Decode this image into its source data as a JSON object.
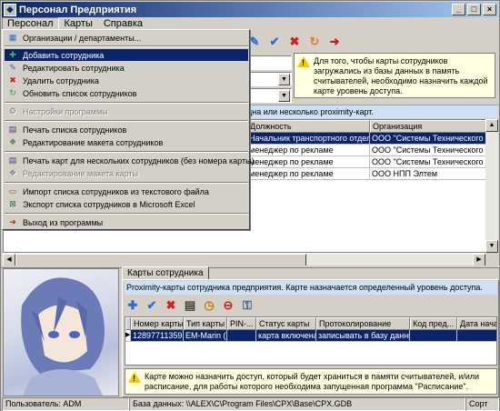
{
  "window": {
    "title": "Персонал Предприятия",
    "controls": [
      "_",
      "□",
      "×"
    ]
  },
  "menubar": {
    "items": [
      "Персонал",
      "Карты",
      "Справка"
    ]
  },
  "dropdown": {
    "items": [
      {
        "label": "Организации / департаменты...",
        "icon": "org-icon"
      },
      {
        "label": "Добавить сотрудника",
        "icon": "add-user-icon"
      },
      {
        "label": "Редактировать сотрудника",
        "icon": "edit-user-icon"
      },
      {
        "label": "Удалить сотрудника",
        "icon": "delete-user-icon"
      },
      {
        "label": "Обновить список сотрудников",
        "icon": "refresh-icon"
      },
      {
        "label": "Настройки программы",
        "icon": "settings-icon"
      },
      {
        "label": "Печать списка сотрудников",
        "icon": "print-icon"
      },
      {
        "label": "Редактирование макета сотрудников",
        "icon": "layout-icon"
      },
      {
        "label": "Печать карт для нескольких сотрудников (без номера карты)",
        "icon": "print-cards-icon"
      },
      {
        "label": "Редактирование макета карты",
        "icon": "card-layout-icon"
      },
      {
        "label": "Импорт списка сотрудников из текстового файла",
        "icon": "import-icon"
      },
      {
        "label": "Экспорт списка сотрудников в Microsoft Excel",
        "icon": "excel-icon"
      },
      {
        "label": "Выход из программы",
        "icon": "exit-icon"
      }
    ]
  },
  "info": {
    "text": "Для того, чтобы карты сотрудников загружались из базы данных в память считывателей, необходимо назначить каждой карте уровень доступа."
  },
  "hint": {
    "text": "дна или несколько proximity-карт."
  },
  "employees": {
    "columns": [
      "Должность",
      "Организация"
    ],
    "rows": [
      [
        "Начальник транспортного отдела",
        "ООО \"Системы Технического Кон"
      ],
      [
        "менеджер по рекламе",
        "ООО \"Системы Технического Кон"
      ],
      [
        "менеджер по рекламе",
        "ООО \"Системы Технического Кон"
      ],
      [
        "менеджер по рекламе",
        "ООО НПП Элтем"
      ]
    ]
  },
  "cards_tab": {
    "label": "Карты сотрудника",
    "hint": "Proximity-карты сотрудника предприятия. Карте назначается определенный уровень доступа.",
    "columns": [
      "Номер карты",
      "Тип карты",
      "PIN-...",
      "Статус карты",
      "Протоколирование",
      "Код пред...",
      "Дата начал"
    ],
    "rows": [
      [
        "12897711359",
        "EM-Marin (НЧ",
        "",
        "карта включена",
        "записывать в базу данных",
        "",
        ""
      ]
    ],
    "info": "Карте можно назначить доступ, который будет храниться в памяти считывателей, и/или расписание, для работы которого необходима запущенная программа \"Расписание\"."
  },
  "status": {
    "user": "Пользователь: ADM",
    "db": "База данных: \\\\ALEX\\C\\Program Files\\CPX\\Base\\CPX.GDB",
    "sort": "Сорт"
  }
}
